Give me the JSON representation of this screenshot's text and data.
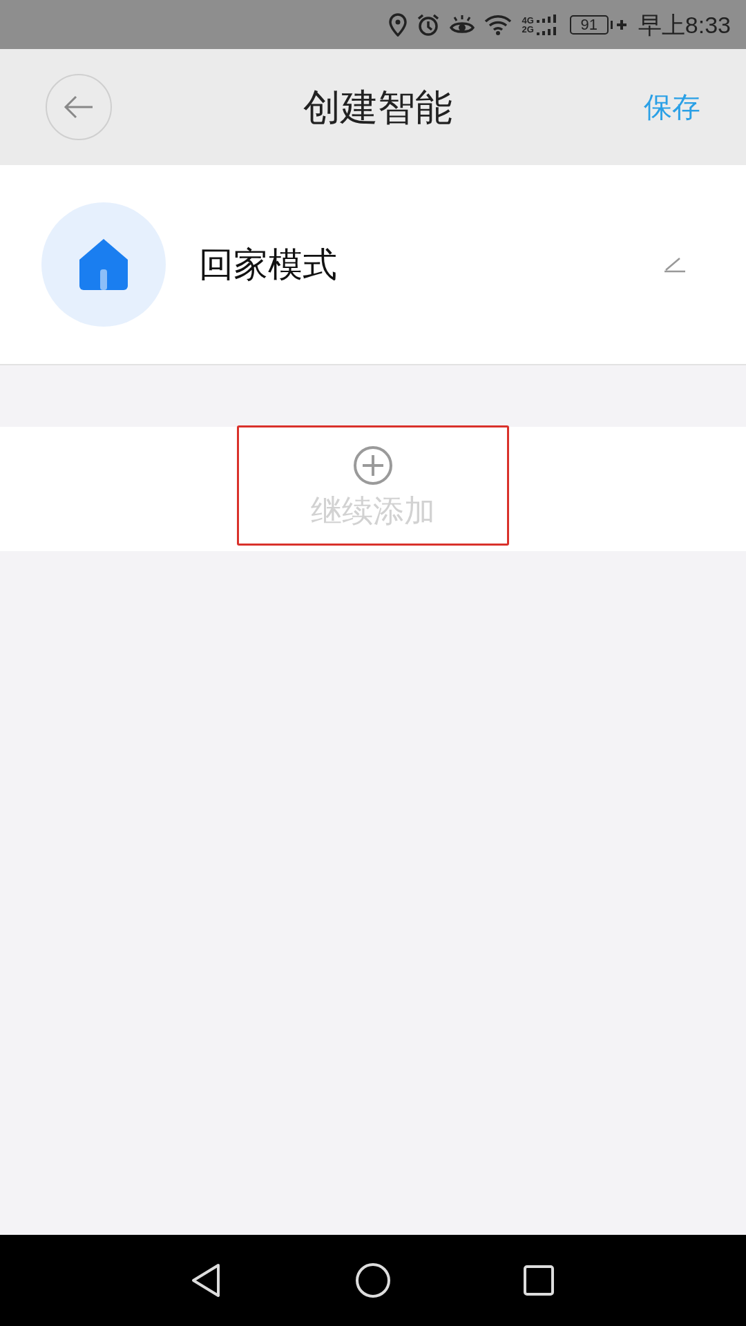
{
  "status_bar": {
    "network_labels": [
      "4G",
      "2G"
    ],
    "battery": "91",
    "time": "早上8:33"
  },
  "header": {
    "title": "创建智能",
    "action": "保存"
  },
  "scene": {
    "name": "回家模式"
  },
  "add_button": {
    "label": "继续添加"
  }
}
